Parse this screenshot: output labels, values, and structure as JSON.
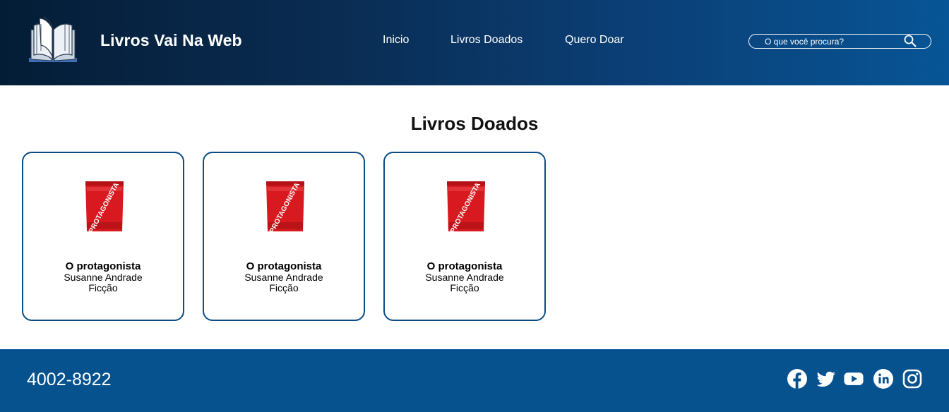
{
  "header": {
    "brand": "Livros Vai Na Web",
    "nav": [
      "Inicio",
      "Livros Doados",
      "Quero Doar"
    ],
    "search_placeholder": "O que você procura?"
  },
  "main": {
    "title": "Livros Doados",
    "books": [
      {
        "title": "O protagonista",
        "author": "Susanne Andrade",
        "genre": "Ficção",
        "cover_text": "PROTAGONISTA"
      },
      {
        "title": "O protagonista",
        "author": "Susanne Andrade",
        "genre": "Ficção",
        "cover_text": "PROTAGONISTA"
      },
      {
        "title": "O protagonista",
        "author": "Susanne Andrade",
        "genre": "Ficção",
        "cover_text": "PROTAGONISTA"
      }
    ]
  },
  "footer": {
    "phone": "4002-8922",
    "social": [
      "facebook-icon",
      "twitter-icon",
      "youtube-icon",
      "linkedin-icon",
      "instagram-icon"
    ]
  },
  "colors": {
    "header_dark": "#041d36",
    "header_light": "#075596",
    "footer": "#06528f",
    "card_border": "#0b4c86",
    "book_cover": "#d8191f"
  }
}
